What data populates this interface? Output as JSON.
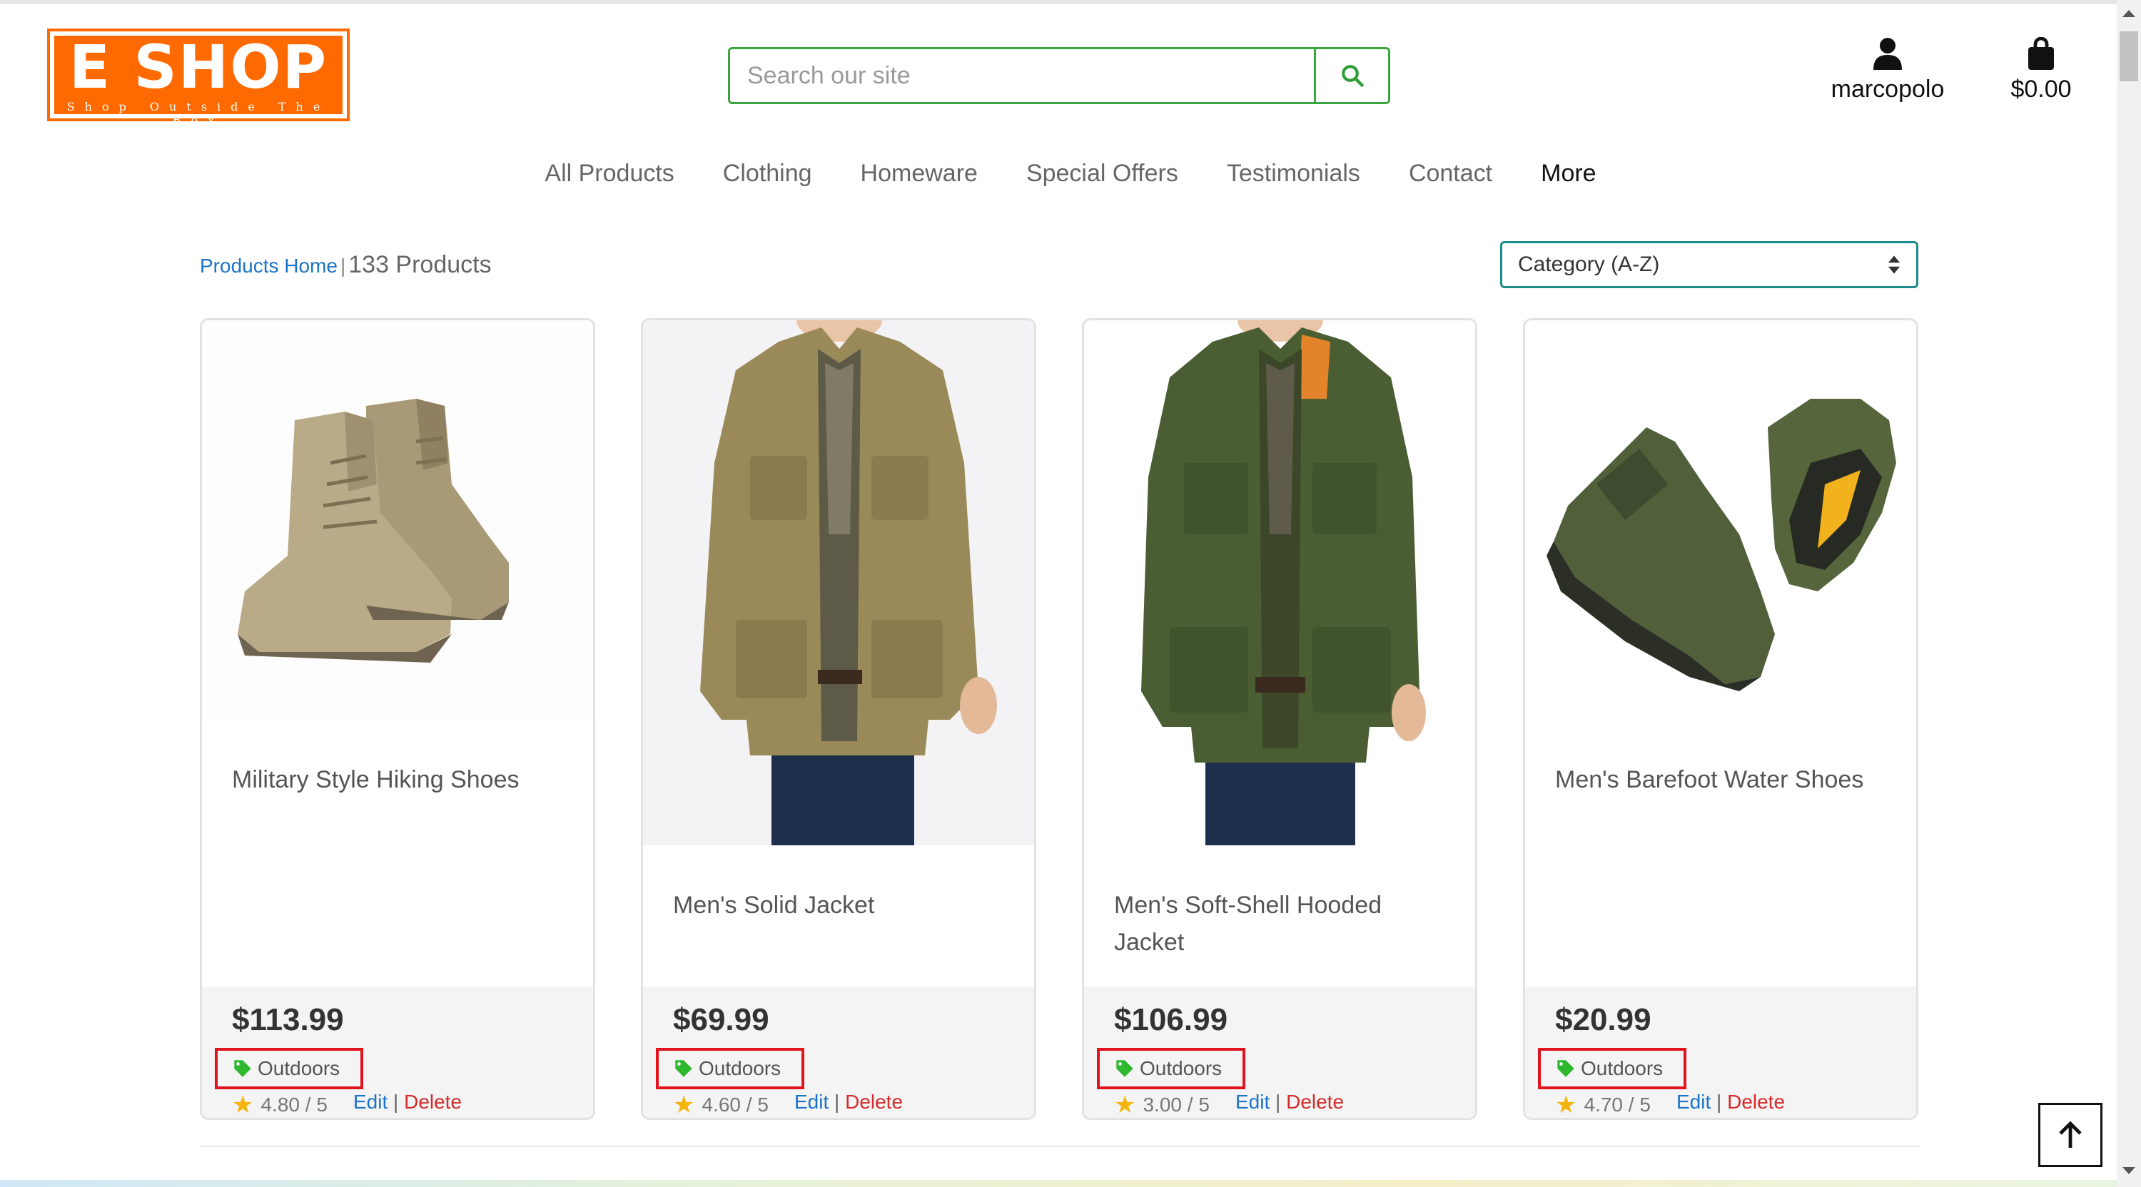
{
  "logo": {
    "title": "E SHOP",
    "tagline": "Shop Outside The Box"
  },
  "search": {
    "placeholder": "Search our site"
  },
  "account": {
    "label": "marcopolo"
  },
  "cart": {
    "total": "$0.00"
  },
  "nav": [
    "All Products",
    "Clothing",
    "Homeware",
    "Special Offers",
    "Testimonials",
    "Contact",
    "More"
  ],
  "breadcrumb": {
    "home": "Products Home",
    "separator": "|",
    "count": "133 Products"
  },
  "sort": {
    "selected": "Category (A-Z)"
  },
  "products": [
    {
      "name": "Military Style Hiking Shoes",
      "price": "$113.99",
      "category": "Outdoors",
      "rating": "4.80 / 5",
      "edit": "Edit",
      "sep": "|",
      "delete": "Delete"
    },
    {
      "name": "Men's Solid Jacket",
      "price": "$69.99",
      "category": "Outdoors",
      "rating": "4.60 / 5",
      "edit": "Edit",
      "sep": "|",
      "delete": "Delete"
    },
    {
      "name": "Men's Soft-Shell Hooded Jacket",
      "price": "$106.99",
      "category": "Outdoors",
      "rating": "3.00 / 5",
      "edit": "Edit",
      "sep": "|",
      "delete": "Delete"
    },
    {
      "name": "Men's Barefoot Water Shoes",
      "price": "$20.99",
      "category": "Outdoors",
      "rating": "4.70 / 5",
      "edit": "Edit",
      "sep": "|",
      "delete": "Delete"
    }
  ],
  "colors": {
    "brand": "#ff6a00",
    "search_border": "#3aa640",
    "link": "#1a73c9",
    "delete": "#d62b2b",
    "highlight": "#e0141e",
    "tag": "#2eb82e",
    "star": "#f3b50d"
  },
  "icons": {
    "search": "magnifier-icon",
    "account": "user-icon",
    "cart": "shopping-bag-icon",
    "category": "tag-icon",
    "rating": "star-icon",
    "scroll_top": "arrow-up-icon"
  }
}
